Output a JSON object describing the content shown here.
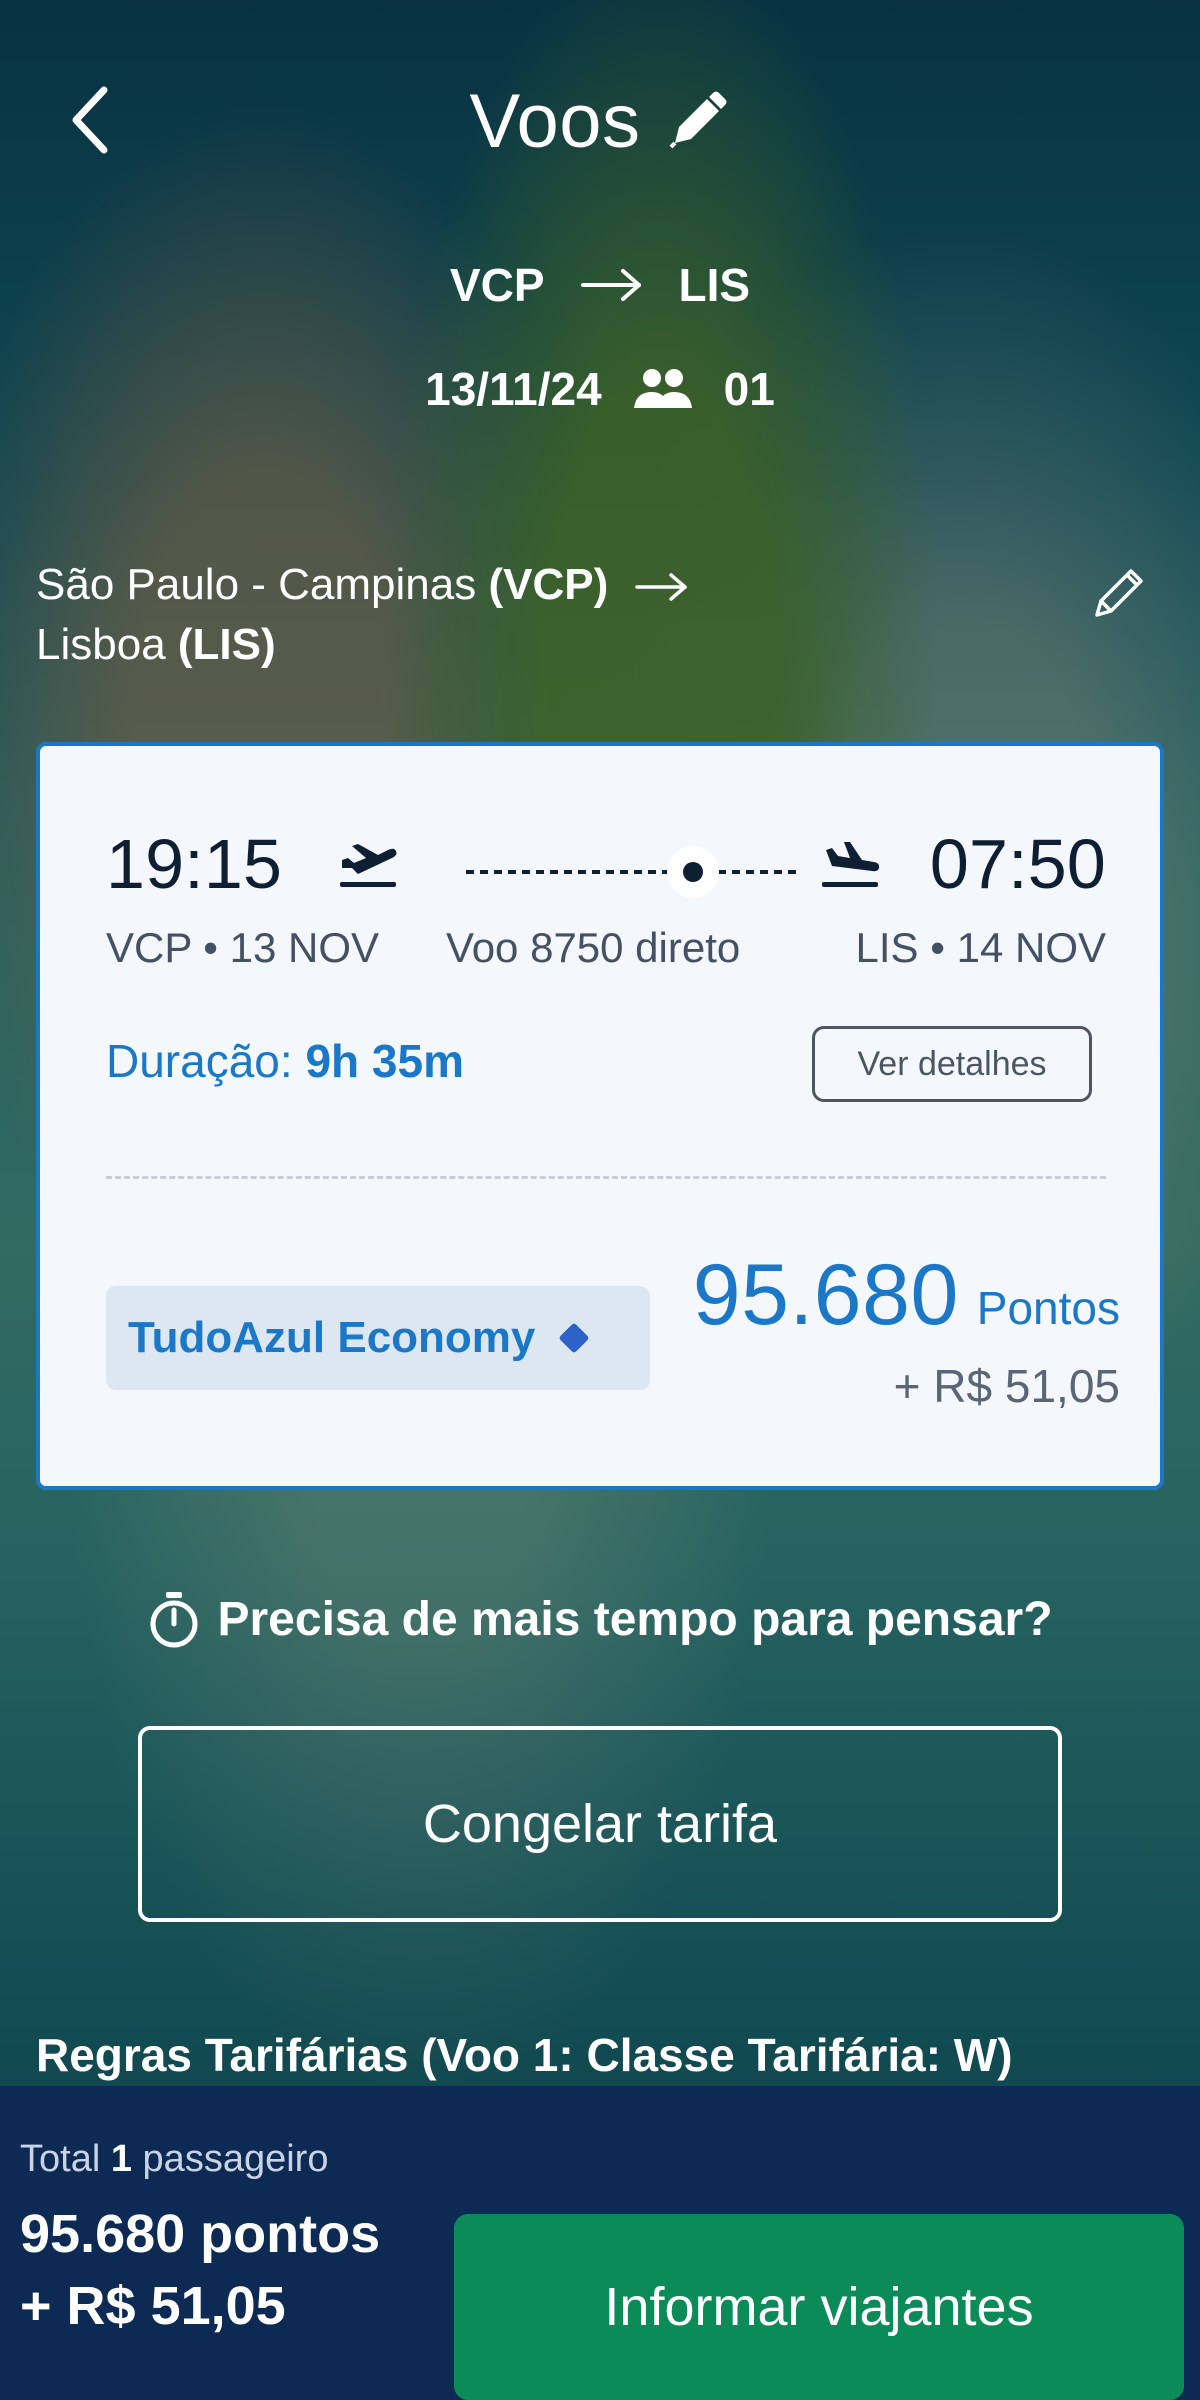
{
  "header": {
    "title": "Voos"
  },
  "trip": {
    "origin_code": "VCP",
    "destination_code": "LIS",
    "date": "13/11/24",
    "passengers": "01"
  },
  "route_description": {
    "origin_city": "São Paulo - Campinas",
    "origin_code_paren": "(VCP)",
    "destination_city": "Lisboa",
    "destination_code_paren": "(LIS)"
  },
  "flight": {
    "dep_time": "19:15",
    "arr_time": "07:50",
    "dep_info": "VCP • 13 NOV",
    "flight_info": "Voo 8750 direto",
    "arr_info": "LIS • 14 NOV",
    "duration_label": "Duração:",
    "duration_value": "9h 35m",
    "details_label": "Ver detalhes",
    "fare_name": "TudoAzul Economy",
    "points": "95.680",
    "points_unit": "Pontos",
    "cash": "+ R$ 51,05"
  },
  "hold": {
    "question": "Precisa de mais tempo para pensar?",
    "button_label": "Congelar tarifa"
  },
  "rules": {
    "label": "Regras Tarifárias (Voo 1: Classe Tarifária: W)"
  },
  "summary": {
    "total_prefix": "Total",
    "passenger_count": "1",
    "passenger_label": "passageiro",
    "points_total": "95.680 pontos",
    "cash_total": "+ R$ 51,05",
    "cta_label": "Informar viajantes"
  },
  "colors": {
    "brand_blue": "#1b78c9",
    "footer_navy": "#0d2a55",
    "cta_green": "#0a8b57"
  }
}
